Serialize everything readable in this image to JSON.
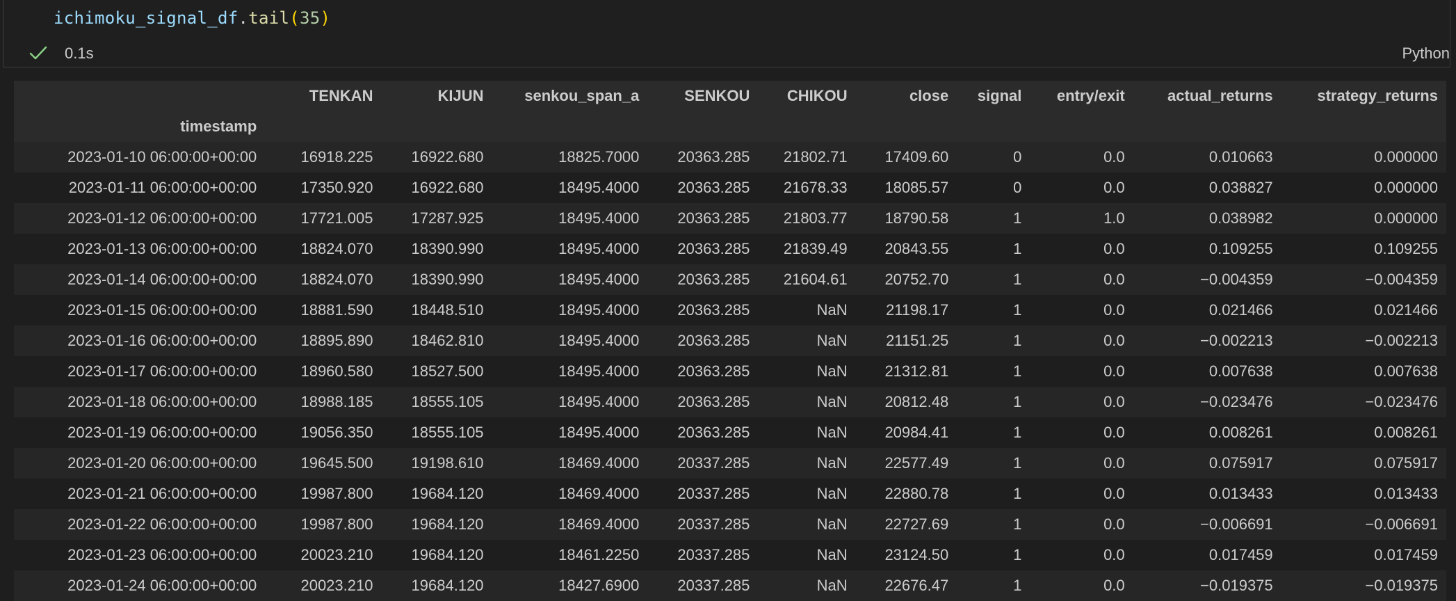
{
  "cell": {
    "code_var": "ichimoku_signal_df",
    "code_dot": ".",
    "code_fn": "tail",
    "code_open": "(",
    "code_arg": "35",
    "code_close": ")",
    "status_icon": "check-icon",
    "exec_time": "0.1s",
    "language": "Python"
  },
  "colors": {
    "background": "#1e1e1e",
    "check": "#89d185",
    "variable": "#9cdcfe",
    "function": "#dcdcaa",
    "number": "#b5cea8",
    "paren": "#ffd700"
  },
  "table": {
    "index_name": "timestamp",
    "columns": [
      "TENKAN",
      "KIJUN",
      "senkou_span_a",
      "SENKOU",
      "CHIKOU",
      "close",
      "signal",
      "entry/exit",
      "actual_returns",
      "strategy_returns"
    ],
    "rows": [
      {
        "index": "2023-01-10 06:00:00+00:00",
        "values": [
          "16918.225",
          "16922.680",
          "18825.7000",
          "20363.285",
          "21802.71",
          "17409.60",
          "0",
          "0.0",
          "0.010663",
          "0.000000"
        ]
      },
      {
        "index": "2023-01-11 06:00:00+00:00",
        "values": [
          "17350.920",
          "16922.680",
          "18495.4000",
          "20363.285",
          "21678.33",
          "18085.57",
          "0",
          "0.0",
          "0.038827",
          "0.000000"
        ]
      },
      {
        "index": "2023-01-12 06:00:00+00:00",
        "values": [
          "17721.005",
          "17287.925",
          "18495.4000",
          "20363.285",
          "21803.77",
          "18790.58",
          "1",
          "1.0",
          "0.038982",
          "0.000000"
        ]
      },
      {
        "index": "2023-01-13 06:00:00+00:00",
        "values": [
          "18824.070",
          "18390.990",
          "18495.4000",
          "20363.285",
          "21839.49",
          "20843.55",
          "1",
          "0.0",
          "0.109255",
          "0.109255"
        ]
      },
      {
        "index": "2023-01-14 06:00:00+00:00",
        "values": [
          "18824.070",
          "18390.990",
          "18495.4000",
          "20363.285",
          "21604.61",
          "20752.70",
          "1",
          "0.0",
          "−0.004359",
          "−0.004359"
        ]
      },
      {
        "index": "2023-01-15 06:00:00+00:00",
        "values": [
          "18881.590",
          "18448.510",
          "18495.4000",
          "20363.285",
          "NaN",
          "21198.17",
          "1",
          "0.0",
          "0.021466",
          "0.021466"
        ]
      },
      {
        "index": "2023-01-16 06:00:00+00:00",
        "values": [
          "18895.890",
          "18462.810",
          "18495.4000",
          "20363.285",
          "NaN",
          "21151.25",
          "1",
          "0.0",
          "−0.002213",
          "−0.002213"
        ]
      },
      {
        "index": "2023-01-17 06:00:00+00:00",
        "values": [
          "18960.580",
          "18527.500",
          "18495.4000",
          "20363.285",
          "NaN",
          "21312.81",
          "1",
          "0.0",
          "0.007638",
          "0.007638"
        ]
      },
      {
        "index": "2023-01-18 06:00:00+00:00",
        "values": [
          "18988.185",
          "18555.105",
          "18495.4000",
          "20363.285",
          "NaN",
          "20812.48",
          "1",
          "0.0",
          "−0.023476",
          "−0.023476"
        ]
      },
      {
        "index": "2023-01-19 06:00:00+00:00",
        "values": [
          "19056.350",
          "18555.105",
          "18495.4000",
          "20363.285",
          "NaN",
          "20984.41",
          "1",
          "0.0",
          "0.008261",
          "0.008261"
        ]
      },
      {
        "index": "2023-01-20 06:00:00+00:00",
        "values": [
          "19645.500",
          "19198.610",
          "18469.4000",
          "20337.285",
          "NaN",
          "22577.49",
          "1",
          "0.0",
          "0.075917",
          "0.075917"
        ]
      },
      {
        "index": "2023-01-21 06:00:00+00:00",
        "values": [
          "19987.800",
          "19684.120",
          "18469.4000",
          "20337.285",
          "NaN",
          "22880.78",
          "1",
          "0.0",
          "0.013433",
          "0.013433"
        ]
      },
      {
        "index": "2023-01-22 06:00:00+00:00",
        "values": [
          "19987.800",
          "19684.120",
          "18469.4000",
          "20337.285",
          "NaN",
          "22727.69",
          "1",
          "0.0",
          "−0.006691",
          "−0.006691"
        ]
      },
      {
        "index": "2023-01-23 06:00:00+00:00",
        "values": [
          "20023.210",
          "19684.120",
          "18461.2250",
          "20337.285",
          "NaN",
          "23124.50",
          "1",
          "0.0",
          "0.017459",
          "0.017459"
        ]
      },
      {
        "index": "2023-01-24 06:00:00+00:00",
        "values": [
          "20023.210",
          "19684.120",
          "18427.6900",
          "20337.285",
          "NaN",
          "22676.47",
          "1",
          "0.0",
          "−0.019375",
          "−0.019375"
        ]
      }
    ]
  }
}
